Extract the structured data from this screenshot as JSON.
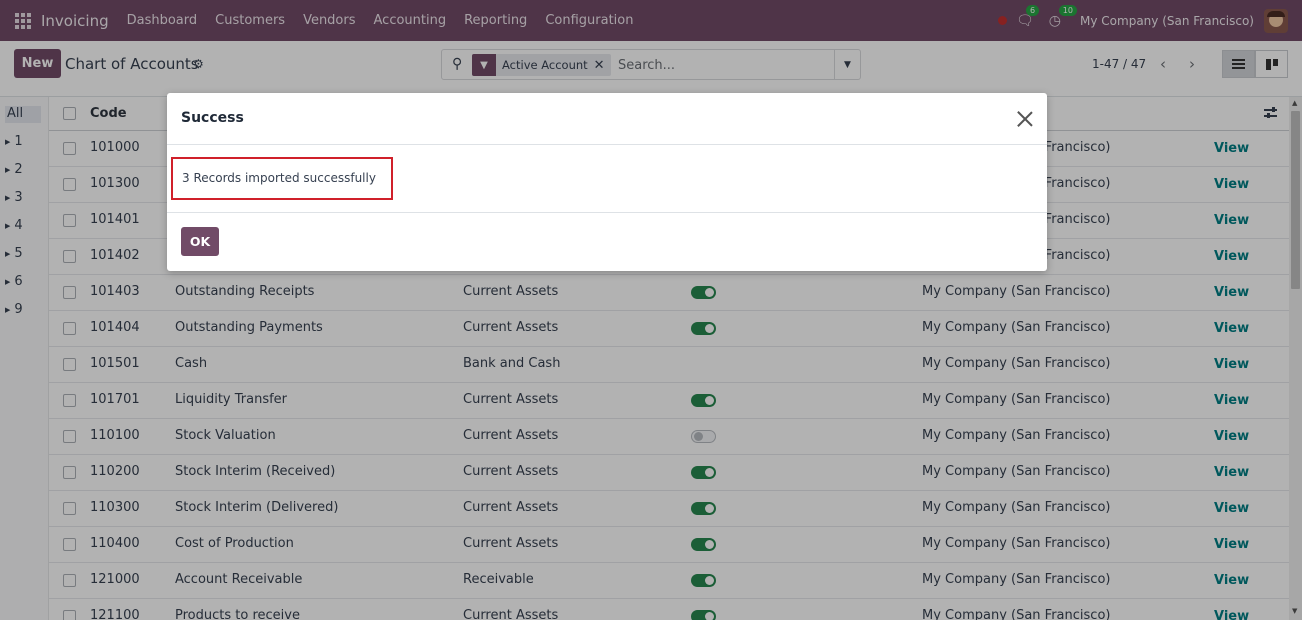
{
  "navbar": {
    "app_name": "Invoicing",
    "menu": [
      "Dashboard",
      "Customers",
      "Vendors",
      "Accounting",
      "Reporting",
      "Configuration"
    ],
    "messages_badge": "6",
    "activities_badge": "10",
    "company": "My Company (San Francisco)"
  },
  "control": {
    "new_label": "New",
    "title": "Chart of Accounts",
    "facet_label": "Active Account",
    "search_placeholder": "Search...",
    "pager": "1-47 / 47"
  },
  "sidepanel": {
    "items": [
      "All",
      "1",
      "2",
      "3",
      "4",
      "5",
      "6",
      "9"
    ]
  },
  "list": {
    "header_code": "Code",
    "view_label": "View",
    "rows": [
      {
        "code": "101000",
        "name": "",
        "type": "",
        "active": null,
        "company": "My Company (San Francisco)"
      },
      {
        "code": "101300",
        "name": "",
        "type": "",
        "active": null,
        "company": "My Company (San Francisco)"
      },
      {
        "code": "101401",
        "name": "",
        "type": "",
        "active": null,
        "company": "My Company (San Francisco)"
      },
      {
        "code": "101402",
        "name": "",
        "type": "",
        "active": null,
        "company": "My Company (San Francisco)"
      },
      {
        "code": "101403",
        "name": "Outstanding Receipts",
        "type": "Current Assets",
        "active": true,
        "company": "My Company (San Francisco)"
      },
      {
        "code": "101404",
        "name": "Outstanding Payments",
        "type": "Current Assets",
        "active": true,
        "company": "My Company (San Francisco)"
      },
      {
        "code": "101501",
        "name": "Cash",
        "type": "Bank and Cash",
        "active": null,
        "company": "My Company (San Francisco)"
      },
      {
        "code": "101701",
        "name": "Liquidity Transfer",
        "type": "Current Assets",
        "active": true,
        "company": "My Company (San Francisco)"
      },
      {
        "code": "110100",
        "name": "Stock Valuation",
        "type": "Current Assets",
        "active": false,
        "company": "My Company (San Francisco)"
      },
      {
        "code": "110200",
        "name": "Stock Interim (Received)",
        "type": "Current Assets",
        "active": true,
        "company": "My Company (San Francisco)"
      },
      {
        "code": "110300",
        "name": "Stock Interim (Delivered)",
        "type": "Current Assets",
        "active": true,
        "company": "My Company (San Francisco)"
      },
      {
        "code": "110400",
        "name": "Cost of Production",
        "type": "Current Assets",
        "active": true,
        "company": "My Company (San Francisco)"
      },
      {
        "code": "121000",
        "name": "Account Receivable",
        "type": "Receivable",
        "active": true,
        "company": "My Company (San Francisco)"
      },
      {
        "code": "121100",
        "name": "Products to receive",
        "type": "Current Assets",
        "active": true,
        "company": "My Company (San Francisco)"
      }
    ]
  },
  "dialog": {
    "title": "Success",
    "message": "3 Records imported successfully",
    "ok_label": "OK"
  },
  "colors": {
    "brand": "#714b67",
    "toggle_on": "#28874f",
    "link": "#017e84",
    "highlight_border": "#d0202a"
  }
}
